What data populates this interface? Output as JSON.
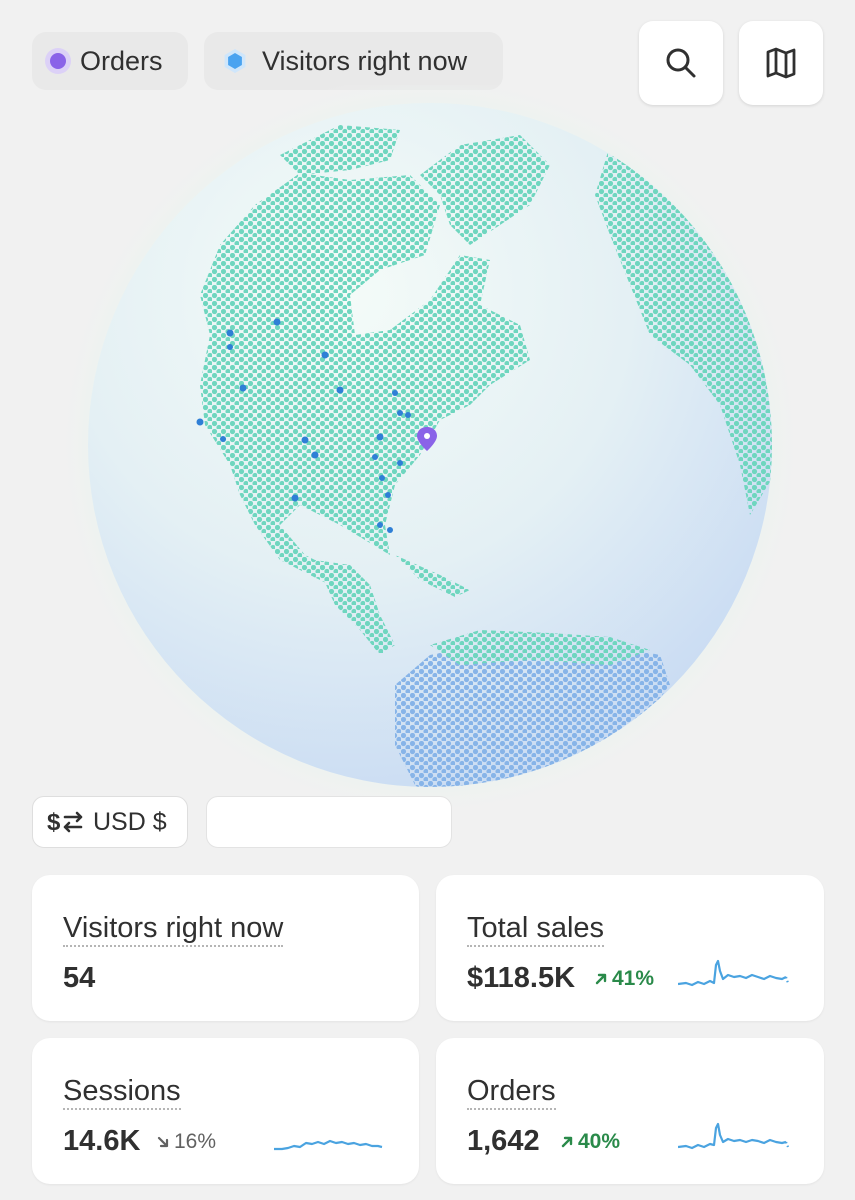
{
  "header": {
    "chips": [
      {
        "label": "Orders",
        "icon": "purple-dot-icon",
        "color": "#8a63e8"
      },
      {
        "label": "Visitors right now",
        "icon": "blue-hexagon-icon",
        "color": "#4aa3f0"
      }
    ],
    "buttons": [
      {
        "icon": "search-icon"
      },
      {
        "icon": "map-icon"
      }
    ]
  },
  "currency": {
    "label": "USD $",
    "icon": "currency-swap-icon"
  },
  "metrics": {
    "visitors": {
      "title": "Visitors right now",
      "value": "54"
    },
    "total_sales": {
      "title": "Total sales",
      "value": "$118.5K",
      "delta": "41%",
      "direction": "up"
    },
    "sessions": {
      "title": "Sessions",
      "value": "14.6K",
      "delta": "16%",
      "direction": "down"
    },
    "orders": {
      "title": "Orders",
      "value": "1,642",
      "delta": "40%",
      "direction": "up"
    }
  },
  "colors": {
    "accent_purple": "#8a63e8",
    "accent_blue": "#4aa3f0",
    "land": "#6fd6bf",
    "positive": "#2a8a4a",
    "spark": "#4aa3e0"
  }
}
